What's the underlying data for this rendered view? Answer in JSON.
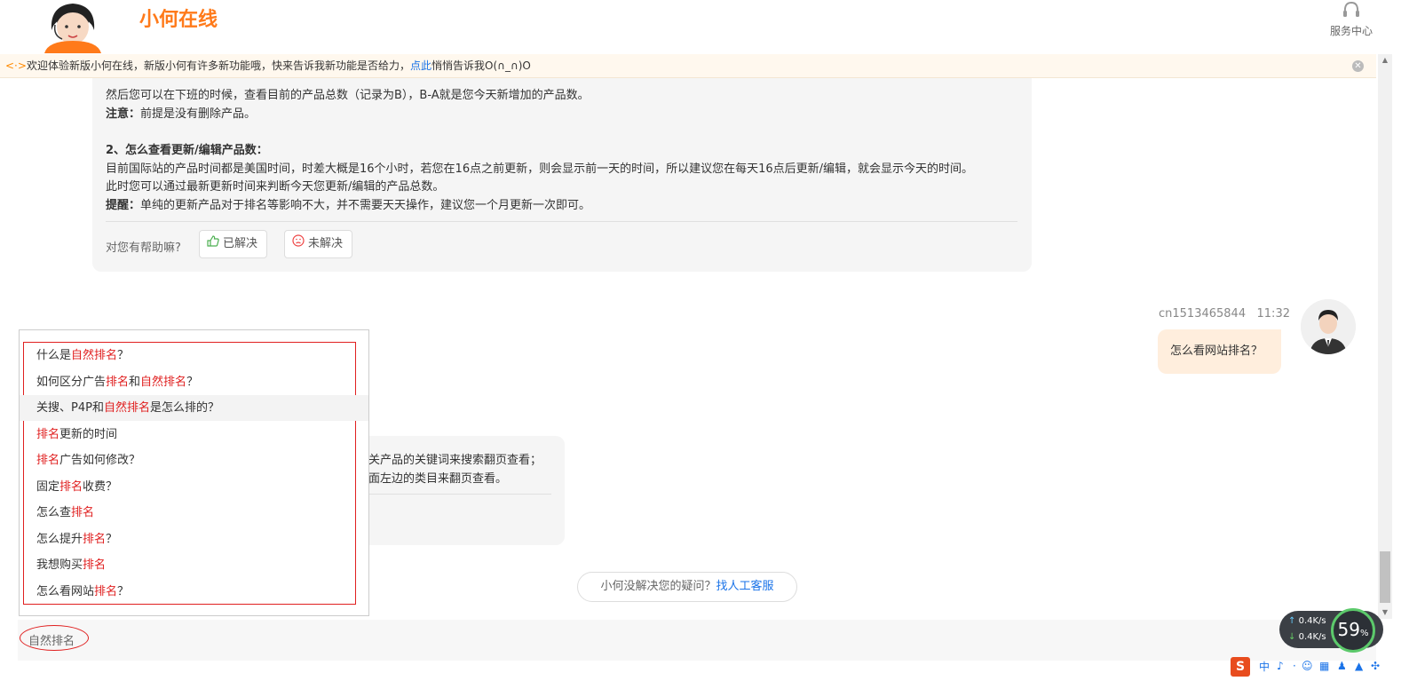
{
  "header": {
    "brand": "小何在线",
    "service_label": "服务中心"
  },
  "notice": {
    "text_before": "欢迎体验新版小何在线，新版小何有许多新功能哦，快来告诉我新功能是否给力，",
    "link": "点此",
    "text_after": "悄悄告诉我O(∩_∩)O"
  },
  "bot_message": {
    "line1": "然后您可以在下班的时候，查看目前的产品总数（记录为B），B-A就是您今天新增加的产品数。",
    "note_label": "注意：",
    "note_text": "前提是没有删除产品。",
    "section2_title": "2、怎么查看更新/编辑产品数：",
    "line3": "目前国际站的产品时间都是美国时间，时差大概是16个小时，若您在16点之前更新，则会显示前一天的时间，所以建议您在每天16点后更新/编辑，就会显示今天的时间。",
    "line4": "此时您可以通过最新更新时间来判断今天您更新/编辑的产品总数。",
    "tip_label": "提醒：",
    "tip_text": "单纯的更新产品对于排名等影响不大，并不需要天天操作，建议您一个月更新一次即可。",
    "helpful_question": "对您有帮助嘛?",
    "solved_label": "已解决",
    "unsolved_label": "未解决"
  },
  "user_message": {
    "username": "cn1513465844",
    "time": "11:32",
    "text": "怎么看网站排名？"
  },
  "bot_message2": {
    "line1": "关产品的关键词来搜索翻页查看；",
    "line2": "面左边的类目来翻页查看。"
  },
  "human_service": {
    "prompt": "小何没解决您的疑问？",
    "link": "找人工客服"
  },
  "suggestions": [
    [
      {
        "t": "什么是",
        "k": false
      },
      {
        "t": "自然排名",
        "k": true
      },
      {
        "t": "？",
        "k": false
      }
    ],
    [
      {
        "t": "如何区分广告",
        "k": false
      },
      {
        "t": "排名",
        "k": true
      },
      {
        "t": "和",
        "k": false
      },
      {
        "t": "自然排名",
        "k": true
      },
      {
        "t": "？",
        "k": false
      }
    ],
    [
      {
        "t": "关搜、P4P和",
        "k": false
      },
      {
        "t": "自然排名",
        "k": true
      },
      {
        "t": "是怎么排的？",
        "k": false
      }
    ],
    [
      {
        "t": "排名",
        "k": true
      },
      {
        "t": "更新的时间",
        "k": false
      }
    ],
    [
      {
        "t": "排名",
        "k": true
      },
      {
        "t": "广告如何修改？",
        "k": false
      }
    ],
    [
      {
        "t": "固定",
        "k": false
      },
      {
        "t": "排名",
        "k": true
      },
      {
        "t": "收费？",
        "k": false
      }
    ],
    [
      {
        "t": "怎么查",
        "k": false
      },
      {
        "t": "排名",
        "k": true
      }
    ],
    [
      {
        "t": "怎么提升",
        "k": false
      },
      {
        "t": "排名",
        "k": true
      },
      {
        "t": "？",
        "k": false
      }
    ],
    [
      {
        "t": "我想购买",
        "k": false
      },
      {
        "t": "排名",
        "k": true
      }
    ],
    [
      {
        "t": "怎么看网站",
        "k": false
      },
      {
        "t": "排名",
        "k": true
      },
      {
        "t": "？",
        "k": false
      }
    ]
  ],
  "highlighted_suggestion_index": 2,
  "input": {
    "value": "自然排名"
  },
  "net_monitor": {
    "upload": "0.4K/s",
    "download": "0.4K/s",
    "percent": "59",
    "percent_unit": "%"
  },
  "ime": {
    "logo": "S",
    "mode": "中"
  },
  "colors": {
    "brand": "#ff7a1a",
    "keyword": "#e02020",
    "link": "#1a73e8",
    "user_bubble": "#ffeedd"
  }
}
